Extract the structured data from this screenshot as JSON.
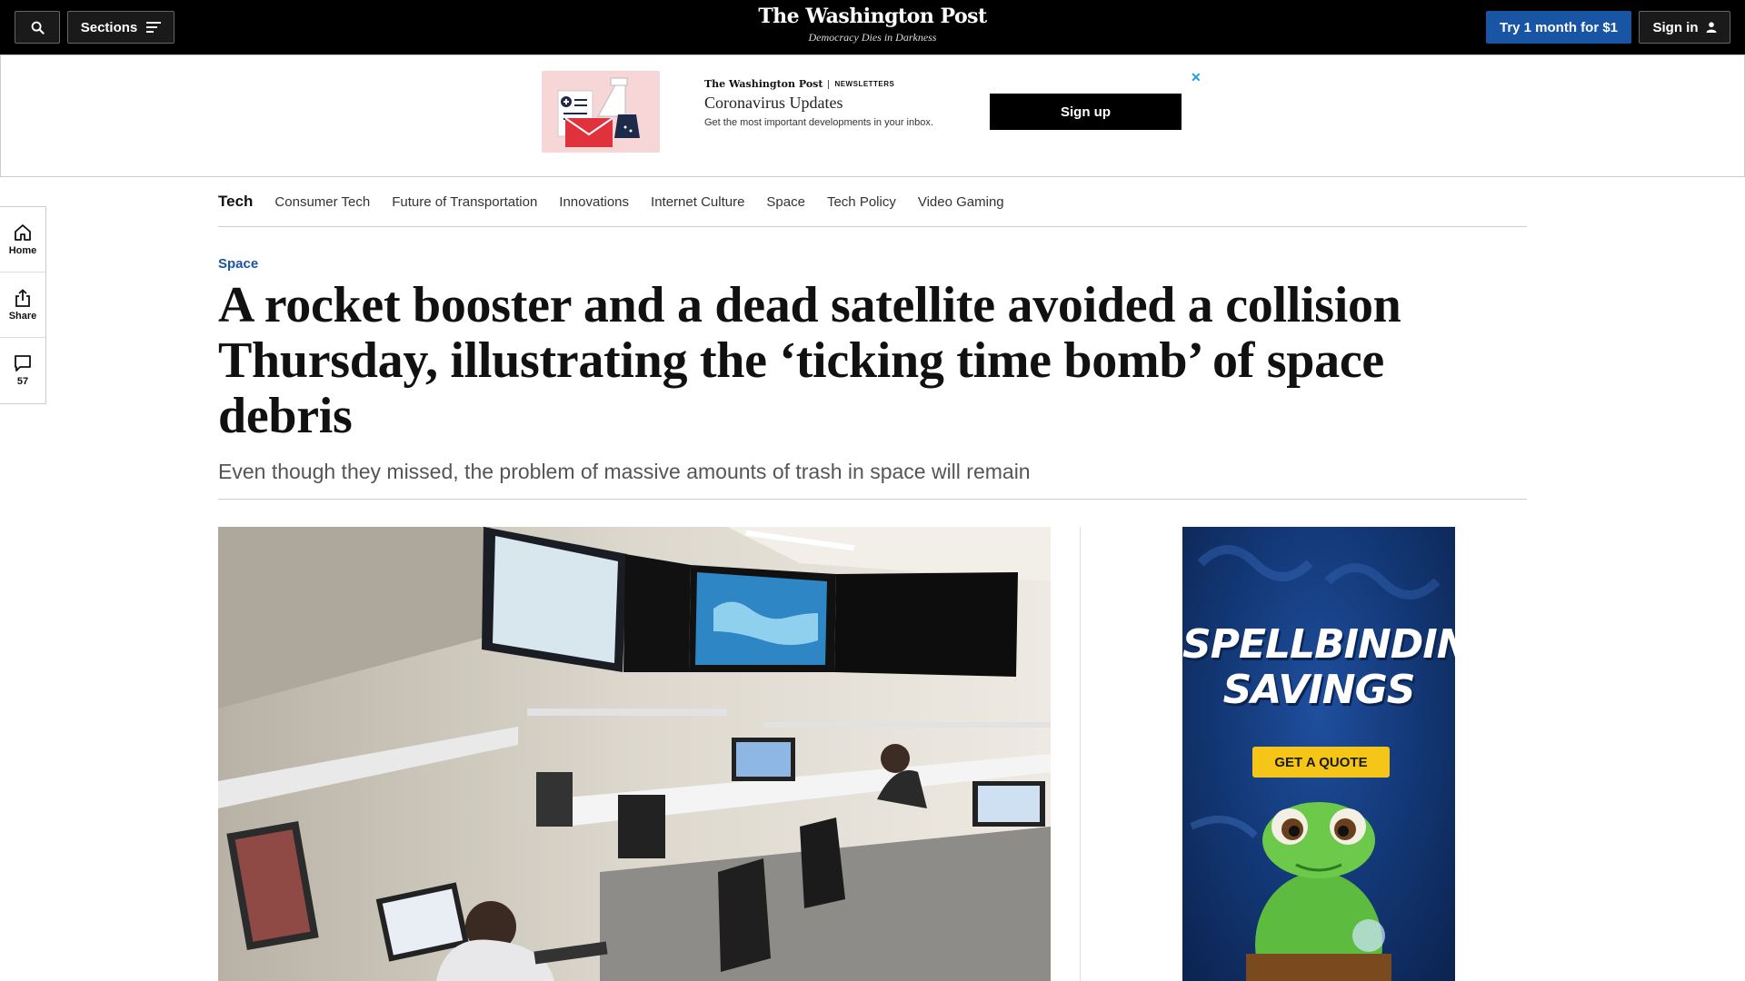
{
  "header": {
    "sections_label": "Sections",
    "logo": "The Washington Post",
    "tagline": "Democracy Dies in Darkness",
    "trial_label": "Try 1 month for $1",
    "signin_label": "Sign in",
    "accent_color": "#1955a5"
  },
  "newsletter_ad": {
    "brand": "The Washington Post",
    "label": "NEWSLETTERS",
    "title": "Coronavirus Updates",
    "description": "Get the most important developments in your inbox.",
    "cta": "Sign up",
    "close_glyph": "✕"
  },
  "subnav": {
    "title": "Tech",
    "items": [
      "Consumer Tech",
      "Future of Transportation",
      "Innovations",
      "Internet Culture",
      "Space",
      "Tech Policy",
      "Video Gaming"
    ]
  },
  "rail": {
    "home_label": "Home",
    "share_label": "Share",
    "comments_count": "57"
  },
  "article": {
    "kicker": "Space",
    "headline": "A rocket booster and a dead satellite avoided a collision Thursday, illustrating the ‘ticking time bomb’ of space debris",
    "dek": "Even though they missed, the problem of massive amounts of trash in space will remain"
  },
  "side_ad": {
    "title_line1": "SPELLBINDING",
    "title_line2": "SAVINGS",
    "cta": "GET A QUOTE"
  }
}
